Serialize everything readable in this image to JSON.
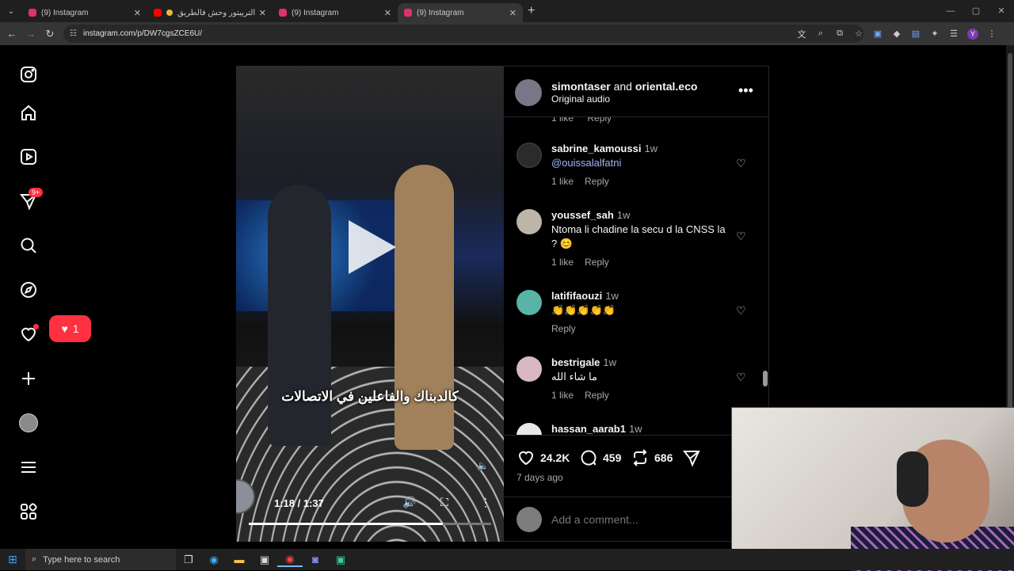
{
  "browser": {
    "tabs": [
      {
        "title": "(9) Instagram",
        "color": "#e1306c",
        "active": false
      },
      {
        "title": "هاد الترييتور وحش فالطريق",
        "color": "#ff0000",
        "active": false
      },
      {
        "title": "(9) Instagram",
        "color": "#e1306c",
        "active": false
      },
      {
        "title": "(9) Instagram",
        "color": "#e1306c",
        "active": true
      }
    ],
    "url": "instagram.com/p/DW7cgsZCE6U/",
    "profile_initial": "Y"
  },
  "sidebar": {
    "message_badge": "9+",
    "notification_count": "1",
    "items": [
      "instagram-logo",
      "home",
      "reels",
      "messages",
      "search",
      "explore",
      "notifications",
      "create",
      "profile",
      "more",
      "meta"
    ]
  },
  "video": {
    "caption": "كالدبناك والفاعلين في الاتصالات",
    "time": "1:18 / 1:37",
    "progress": 0.8
  },
  "post": {
    "author": "simontaser",
    "joiner": "and",
    "coauthor": "oriental.eco",
    "audio": "Original audio",
    "more": "•••",
    "likes": "24.2K",
    "comments_count": "459",
    "reposts": "686",
    "posted": "7 days ago",
    "add_comment_placeholder": "Add a comment..."
  },
  "comments_top": {
    "likes": "1 like",
    "reply": "Reply"
  },
  "comments": [
    {
      "user": "sabrine_kamoussi",
      "ago": "1w",
      "text": "@ouissalalfatni",
      "likes": "1 like",
      "reply": "Reply",
      "link": true,
      "color": "#2b2b2b"
    },
    {
      "user": "youssef_sah",
      "ago": "1w",
      "text": "Ntoma li chadine la secu d la CNSS la ? 😊",
      "likes": "1 like",
      "reply": "Reply",
      "link": false,
      "color": "#bcb6a8"
    },
    {
      "user": "latififaouzi",
      "ago": "1w",
      "text": "👏👏👏👏👏",
      "likes": "",
      "reply": "Reply",
      "link": false,
      "color": "#59b4a8"
    },
    {
      "user": "bestrigale",
      "ago": "1w",
      "text": "ما شاء الله",
      "likes": "1 like",
      "reply": "Reply",
      "link": false,
      "color": "#d9b8c2"
    },
    {
      "user": "hassan_aarab1",
      "ago": "1w",
      "text": "",
      "likes": "",
      "reply": "",
      "link": false,
      "color": "#e8e8e8"
    }
  ],
  "taskbar": {
    "search_placeholder": "Type here to search"
  }
}
